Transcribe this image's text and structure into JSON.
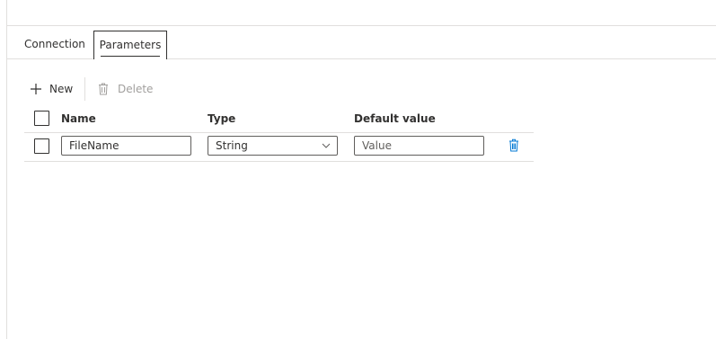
{
  "tabs": {
    "connection": "Connection",
    "parameters": "Parameters"
  },
  "toolbar": {
    "new_label": "New",
    "delete_label": "Delete"
  },
  "table": {
    "headers": {
      "name": "Name",
      "type": "Type",
      "default_value": "Default value"
    },
    "rows": [
      {
        "name": "FileName",
        "type": "String",
        "default_value": "",
        "default_placeholder": "Value"
      }
    ]
  },
  "colors": {
    "text": "#323130",
    "border": "#e1dfdd",
    "disabled": "#a19f9d",
    "delete_icon": "#0078d4"
  }
}
